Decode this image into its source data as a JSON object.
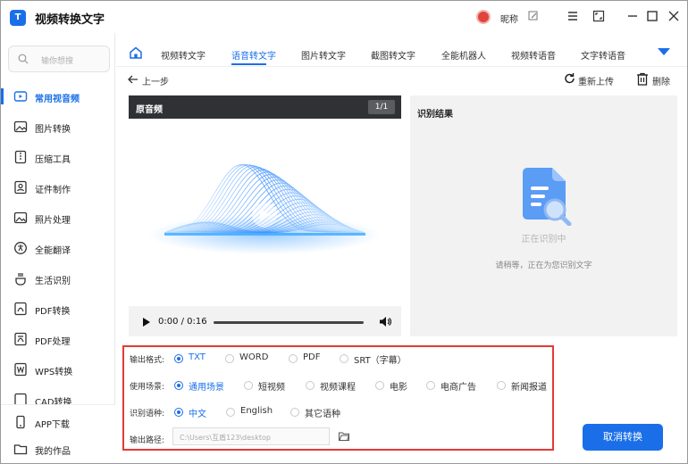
{
  "app": {
    "title": "视频转换文字",
    "logo_text": "T"
  },
  "user": {
    "nickname": "昵称"
  },
  "sidebar": {
    "search_placeholder": "输你想搜",
    "items": [
      {
        "label": "常用视音频",
        "icon": "video-icon",
        "active": true
      },
      {
        "label": "图片转换",
        "icon": "image-icon"
      },
      {
        "label": "压缩工具",
        "icon": "compress-icon"
      },
      {
        "label": "证件制作",
        "icon": "id-card-icon"
      },
      {
        "label": "照片处理",
        "icon": "photo-icon"
      },
      {
        "label": "全能翻译",
        "icon": "translate-icon"
      },
      {
        "label": "生活识别",
        "icon": "scan-icon"
      },
      {
        "label": "PDF转换",
        "icon": "pdf-icon"
      },
      {
        "label": "PDF处理",
        "icon": "pdf-edit-icon"
      },
      {
        "label": "WPS转换",
        "icon": "wps-icon"
      },
      {
        "label": "CAD转换",
        "icon": "cad-icon"
      }
    ],
    "bottom": [
      {
        "label": "APP下载",
        "icon": "phone-icon"
      },
      {
        "label": "我的作品",
        "icon": "folder-icon"
      }
    ]
  },
  "tabs": [
    {
      "label": "视频转文字"
    },
    {
      "label": "语音转文字",
      "active": true
    },
    {
      "label": "图片转文字"
    },
    {
      "label": "截图转文字"
    },
    {
      "label": "全能机器人"
    },
    {
      "label": "视频转语音"
    },
    {
      "label": "文字转语音"
    }
  ],
  "actions": {
    "back": "上一步",
    "reupload": "重新上传",
    "delete": "删除"
  },
  "player": {
    "title": "原音频",
    "page": "1/1",
    "time": "0:00 / 0:16",
    "progress": 0
  },
  "result": {
    "title": "识别结果",
    "status": "正在识别中",
    "hint": "请稍等，正在为您识别文字"
  },
  "options": {
    "format": {
      "label": "输出格式:",
      "choices": [
        "TXT",
        "WORD",
        "PDF",
        "SRT（字幕）"
      ],
      "selected": "TXT"
    },
    "scene": {
      "label": "使用场景:",
      "choices": [
        "通用场景",
        "短视频",
        "视频课程",
        "电影",
        "电商广告",
        "新闻报道"
      ],
      "selected": "通用场景"
    },
    "language": {
      "label": "识别语种:",
      "choices": [
        "中文",
        "English",
        "其它语种"
      ],
      "selected": "中文"
    },
    "path": {
      "label": "输出路径:",
      "value": "C:\\Users\\互盾123\\desktop"
    }
  },
  "cancel_button": "取消转换",
  "colors": {
    "accent": "#1a6fe8",
    "highlight_border": "#e53935",
    "player_header": "#2f3134"
  }
}
